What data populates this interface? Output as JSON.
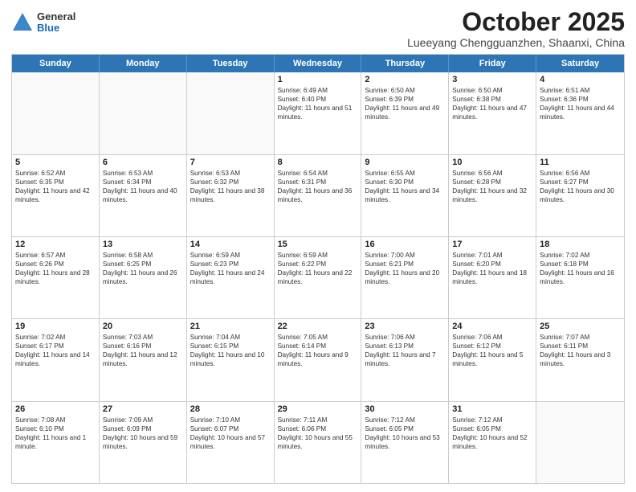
{
  "logo": {
    "general": "General",
    "blue": "Blue"
  },
  "title": "October 2025",
  "subtitle": "Lueeyang Chengguanzhen, Shaanxi, China",
  "header_days": [
    "Sunday",
    "Monday",
    "Tuesday",
    "Wednesday",
    "Thursday",
    "Friday",
    "Saturday"
  ],
  "weeks": [
    [
      {
        "day": "",
        "sunrise": "",
        "sunset": "",
        "daylight": ""
      },
      {
        "day": "",
        "sunrise": "",
        "sunset": "",
        "daylight": ""
      },
      {
        "day": "",
        "sunrise": "",
        "sunset": "",
        "daylight": ""
      },
      {
        "day": "1",
        "sunrise": "Sunrise: 6:49 AM",
        "sunset": "Sunset: 6:40 PM",
        "daylight": "Daylight: 11 hours and 51 minutes."
      },
      {
        "day": "2",
        "sunrise": "Sunrise: 6:50 AM",
        "sunset": "Sunset: 6:39 PM",
        "daylight": "Daylight: 11 hours and 49 minutes."
      },
      {
        "day": "3",
        "sunrise": "Sunrise: 6:50 AM",
        "sunset": "Sunset: 6:38 PM",
        "daylight": "Daylight: 11 hours and 47 minutes."
      },
      {
        "day": "4",
        "sunrise": "Sunrise: 6:51 AM",
        "sunset": "Sunset: 6:36 PM",
        "daylight": "Daylight: 11 hours and 44 minutes."
      }
    ],
    [
      {
        "day": "5",
        "sunrise": "Sunrise: 6:52 AM",
        "sunset": "Sunset: 6:35 PM",
        "daylight": "Daylight: 11 hours and 42 minutes."
      },
      {
        "day": "6",
        "sunrise": "Sunrise: 6:53 AM",
        "sunset": "Sunset: 6:34 PM",
        "daylight": "Daylight: 11 hours and 40 minutes."
      },
      {
        "day": "7",
        "sunrise": "Sunrise: 6:53 AM",
        "sunset": "Sunset: 6:32 PM",
        "daylight": "Daylight: 11 hours and 38 minutes."
      },
      {
        "day": "8",
        "sunrise": "Sunrise: 6:54 AM",
        "sunset": "Sunset: 6:31 PM",
        "daylight": "Daylight: 11 hours and 36 minutes."
      },
      {
        "day": "9",
        "sunrise": "Sunrise: 6:55 AM",
        "sunset": "Sunset: 6:30 PM",
        "daylight": "Daylight: 11 hours and 34 minutes."
      },
      {
        "day": "10",
        "sunrise": "Sunrise: 6:56 AM",
        "sunset": "Sunset: 6:28 PM",
        "daylight": "Daylight: 11 hours and 32 minutes."
      },
      {
        "day": "11",
        "sunrise": "Sunrise: 6:56 AM",
        "sunset": "Sunset: 6:27 PM",
        "daylight": "Daylight: 11 hours and 30 minutes."
      }
    ],
    [
      {
        "day": "12",
        "sunrise": "Sunrise: 6:57 AM",
        "sunset": "Sunset: 6:26 PM",
        "daylight": "Daylight: 11 hours and 28 minutes."
      },
      {
        "day": "13",
        "sunrise": "Sunrise: 6:58 AM",
        "sunset": "Sunset: 6:25 PM",
        "daylight": "Daylight: 11 hours and 26 minutes."
      },
      {
        "day": "14",
        "sunrise": "Sunrise: 6:59 AM",
        "sunset": "Sunset: 6:23 PM",
        "daylight": "Daylight: 11 hours and 24 minutes."
      },
      {
        "day": "15",
        "sunrise": "Sunrise: 6:59 AM",
        "sunset": "Sunset: 6:22 PM",
        "daylight": "Daylight: 11 hours and 22 minutes."
      },
      {
        "day": "16",
        "sunrise": "Sunrise: 7:00 AM",
        "sunset": "Sunset: 6:21 PM",
        "daylight": "Daylight: 11 hours and 20 minutes."
      },
      {
        "day": "17",
        "sunrise": "Sunrise: 7:01 AM",
        "sunset": "Sunset: 6:20 PM",
        "daylight": "Daylight: 11 hours and 18 minutes."
      },
      {
        "day": "18",
        "sunrise": "Sunrise: 7:02 AM",
        "sunset": "Sunset: 6:18 PM",
        "daylight": "Daylight: 11 hours and 16 minutes."
      }
    ],
    [
      {
        "day": "19",
        "sunrise": "Sunrise: 7:02 AM",
        "sunset": "Sunset: 6:17 PM",
        "daylight": "Daylight: 11 hours and 14 minutes."
      },
      {
        "day": "20",
        "sunrise": "Sunrise: 7:03 AM",
        "sunset": "Sunset: 6:16 PM",
        "daylight": "Daylight: 11 hours and 12 minutes."
      },
      {
        "day": "21",
        "sunrise": "Sunrise: 7:04 AM",
        "sunset": "Sunset: 6:15 PM",
        "daylight": "Daylight: 11 hours and 10 minutes."
      },
      {
        "day": "22",
        "sunrise": "Sunrise: 7:05 AM",
        "sunset": "Sunset: 6:14 PM",
        "daylight": "Daylight: 11 hours and 9 minutes."
      },
      {
        "day": "23",
        "sunrise": "Sunrise: 7:06 AM",
        "sunset": "Sunset: 6:13 PM",
        "daylight": "Daylight: 11 hours and 7 minutes."
      },
      {
        "day": "24",
        "sunrise": "Sunrise: 7:06 AM",
        "sunset": "Sunset: 6:12 PM",
        "daylight": "Daylight: 11 hours and 5 minutes."
      },
      {
        "day": "25",
        "sunrise": "Sunrise: 7:07 AM",
        "sunset": "Sunset: 6:11 PM",
        "daylight": "Daylight: 11 hours and 3 minutes."
      }
    ],
    [
      {
        "day": "26",
        "sunrise": "Sunrise: 7:08 AM",
        "sunset": "Sunset: 6:10 PM",
        "daylight": "Daylight: 11 hours and 1 minute."
      },
      {
        "day": "27",
        "sunrise": "Sunrise: 7:09 AM",
        "sunset": "Sunset: 6:09 PM",
        "daylight": "Daylight: 10 hours and 59 minutes."
      },
      {
        "day": "28",
        "sunrise": "Sunrise: 7:10 AM",
        "sunset": "Sunset: 6:07 PM",
        "daylight": "Daylight: 10 hours and 57 minutes."
      },
      {
        "day": "29",
        "sunrise": "Sunrise: 7:11 AM",
        "sunset": "Sunset: 6:06 PM",
        "daylight": "Daylight: 10 hours and 55 minutes."
      },
      {
        "day": "30",
        "sunrise": "Sunrise: 7:12 AM",
        "sunset": "Sunset: 6:05 PM",
        "daylight": "Daylight: 10 hours and 53 minutes."
      },
      {
        "day": "31",
        "sunrise": "Sunrise: 7:12 AM",
        "sunset": "Sunset: 6:05 PM",
        "daylight": "Daylight: 10 hours and 52 minutes."
      },
      {
        "day": "",
        "sunrise": "",
        "sunset": "",
        "daylight": ""
      }
    ]
  ]
}
